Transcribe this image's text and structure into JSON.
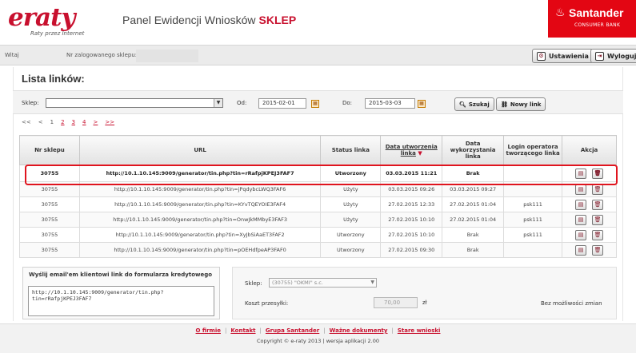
{
  "header": {
    "logo_text": "eraty",
    "logo_tagline": "Raty przez Internet",
    "title": "Panel Ewidencji Wniosków",
    "title_highlight": "SKLEP",
    "bank_name": "Santander",
    "bank_sub": "CONSUMER BANK"
  },
  "topbar": {
    "welcome_label": "Witaj",
    "shop_number_label": "Nr zalogowanego sklepu:",
    "settings_label": "Ustawienia",
    "logout_label": "Wyloguj"
  },
  "list": {
    "title": "Lista linków:"
  },
  "filters": {
    "shop_label": "Sklep:",
    "shop_value": "",
    "from_label": "Od:",
    "from_value": "2015-02-01",
    "to_label": "Do:",
    "to_value": "2015-03-03",
    "search_label": "Szukaj",
    "new_link_label": "Nowy link"
  },
  "pager": {
    "first": "<<",
    "prev": "<",
    "current": "1",
    "pages": [
      "2",
      "3",
      "4"
    ],
    "next": ">",
    "last": ">>"
  },
  "table": {
    "columns": [
      "Nr sklepu",
      "URL",
      "Status linka",
      "Data utworzenia linka",
      "Data wykorzystania linka",
      "Login operatora tworzącego linka",
      "Akcja"
    ],
    "rows": [
      {
        "shop": "30755",
        "url": "http://10.1.10.145:9009/generator/tin.php?tin=rRafpjKPEJ3FAF7",
        "status": "Utworzony",
        "created": "03.03.2015 11:21",
        "used": "Brak",
        "login": ""
      },
      {
        "shop": "30755",
        "url": "http://10.1.10.145:9009/generator/tin.php?tin=jPqdybcLWQ3FAF6",
        "status": "Użyty",
        "created": "03.03.2015 09:26",
        "used": "03.03.2015 09:27",
        "login": ""
      },
      {
        "shop": "30755",
        "url": "http://10.1.10.145:9009/generator/tin.php?tin=KYvTQEYOIE3FAF4",
        "status": "Użyty",
        "created": "27.02.2015 12:33",
        "used": "27.02.2015 01:04",
        "login": "psk111"
      },
      {
        "shop": "30755",
        "url": "http://10.1.10.145:9009/generator/tin.php?tin=OnwJkMMbyE3FAF3",
        "status": "Użyty",
        "created": "27.02.2015 10:10",
        "used": "27.02.2015 01:04",
        "login": "psk111"
      },
      {
        "shop": "30755",
        "url": "http://10.1.10.145:9009/generator/tin.php?tin=XyJbSiAaET3FAF2",
        "status": "Utworzony",
        "created": "27.02.2015 10:10",
        "used": "Brak",
        "login": "psk111"
      },
      {
        "shop": "30755",
        "url": "http://10.1.10.145:9009/generator/tin.php?tin=pOEHdfpeAP3FAF0",
        "status": "Utworzony",
        "created": "27.02.2015 09:30",
        "used": "Brak",
        "login": ""
      }
    ]
  },
  "email": {
    "title": "Wyślij email'em klientowi link do formularza kredytowego",
    "text": "http://10.1.10.145:9009/generator/tin.php?tin=rRafpjKPEJ3FAF7"
  },
  "form": {
    "shop_label": "Sklep:",
    "shop_value": "(30755) \"OKMI\" s.c.",
    "cost_label": "Koszt przesyłki:",
    "cost_value": "70,00",
    "cost_unit": "zł",
    "no_change_label": "Bez możliwości zmian"
  },
  "footer": {
    "links": [
      "O firmie",
      "Kontakt",
      "Grupa Santander",
      "Ważne dokumenty",
      "Stare wnioski"
    ],
    "copyright": "Copyright © e-raty 2013 | wersja aplikacji 2.00"
  },
  "colors": {
    "brand_red": "#c8102e",
    "bank_red": "#e30613",
    "highlight_outline": "#e0141e"
  }
}
